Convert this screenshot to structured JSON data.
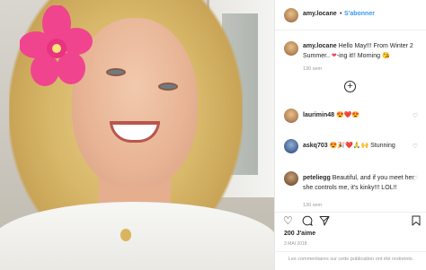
{
  "header": {
    "username": "amy.locane",
    "separator": "•",
    "follow_label": "S'abonner"
  },
  "caption": {
    "username": "amy.locane",
    "text_1": "Hello May!!! From Winter 2 Summer.. ",
    "heart": "❤",
    "text_2": "-ing it!! Morning ",
    "emoji": "😘",
    "time": "130 sem"
  },
  "load_more_icon": "plus-circle-icon",
  "comments": [
    {
      "username": "laurimin48",
      "text": "😍❤️😍",
      "time": ""
    },
    {
      "username": "askq703",
      "text": "😍🎉❤️🙏🙌 Stunning",
      "time": ""
    },
    {
      "username": "peteliegg",
      "text": "Beautiful, and if you meet her she controls me, it's kinky!!! LOL!!",
      "time": "130 sem"
    }
  ],
  "actions": {
    "like_icon": "heart-outline-icon",
    "comment_icon": "comment-icon",
    "share_icon": "share-icon",
    "save_icon": "bookmark-icon"
  },
  "likes_text": "200 J'aime",
  "date_text": "3 MAI 2018",
  "footer_text": "Les commentaires sur cette publication ont été restreints.",
  "colors": {
    "link_blue": "#3897f0",
    "heart_red": "#ed4956",
    "text": "#262626",
    "muted": "#999999"
  }
}
